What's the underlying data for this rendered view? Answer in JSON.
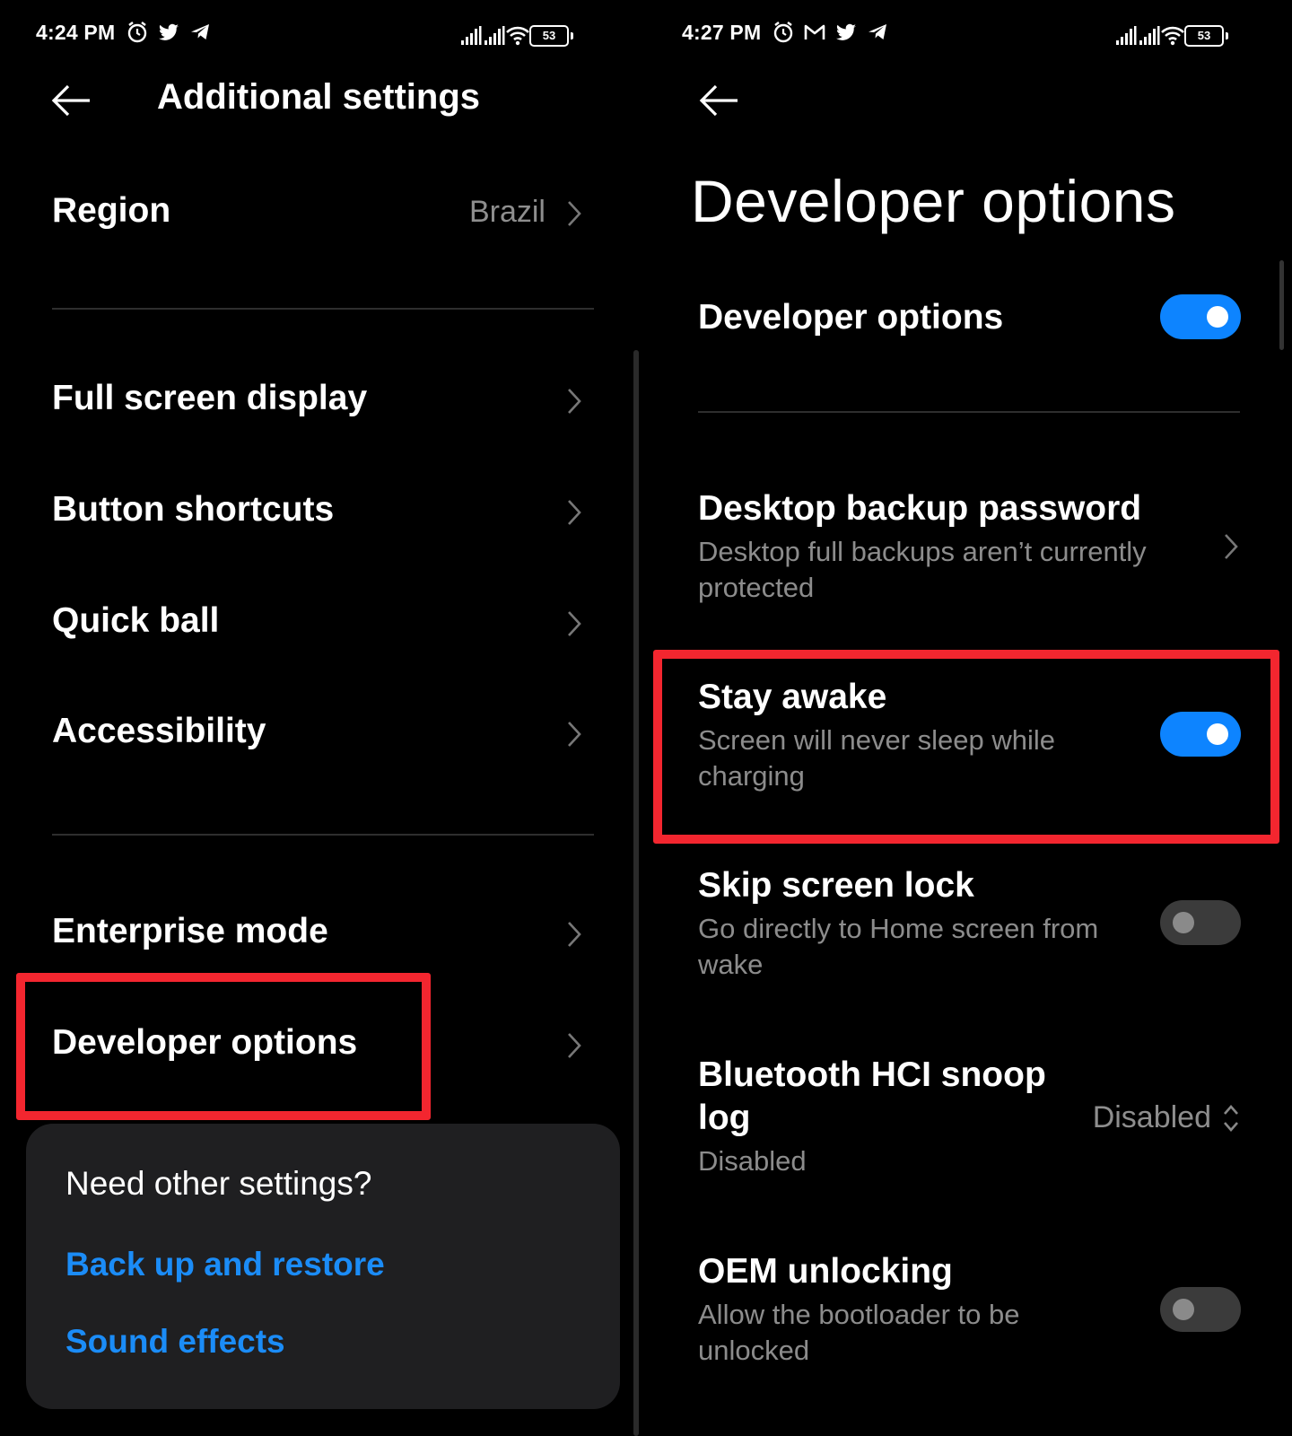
{
  "colors": {
    "accent": "#0d84ff",
    "link": "#1b8cf7",
    "highlight": "#f3262f",
    "background": "#000000"
  },
  "left": {
    "status": {
      "time": "4:24 PM",
      "battery": "53",
      "icons": [
        "alarm-icon",
        "twitter-icon",
        "telegram-icon"
      ]
    },
    "header": {
      "title": "Additional settings"
    },
    "region": {
      "label": "Region",
      "value": "Brazil"
    },
    "items": [
      {
        "label": "Full screen display"
      },
      {
        "label": "Button shortcuts"
      },
      {
        "label": "Quick ball"
      },
      {
        "label": "Accessibility"
      }
    ],
    "enterprise": {
      "label": "Enterprise mode"
    },
    "developer": {
      "label": "Developer options"
    },
    "card": {
      "question": "Need other settings?",
      "links": [
        "Back up and restore",
        "Sound effects"
      ]
    }
  },
  "right": {
    "status": {
      "time": "4:27 PM",
      "battery": "53",
      "icons": [
        "alarm-icon",
        "gmail-icon",
        "twitter-icon",
        "telegram-icon"
      ]
    },
    "page_title": "Developer options",
    "master": {
      "label": "Developer options",
      "enabled": true
    },
    "settings": [
      {
        "title": "Desktop backup password",
        "subtitle": "Desktop full backups aren’t currently protected"
      },
      {
        "title": "Stay awake",
        "subtitle": "Screen will never sleep while charging",
        "enabled": true
      },
      {
        "title": "Skip screen lock",
        "subtitle": "Go directly to Home screen from wake",
        "enabled": false
      },
      {
        "title": "Bluetooth HCI snoop log",
        "subtitle": "Disabled",
        "value": "Disabled"
      },
      {
        "title": "OEM unlocking",
        "subtitle": "Allow the bootloader to be unlocked",
        "enabled": false
      }
    ]
  }
}
